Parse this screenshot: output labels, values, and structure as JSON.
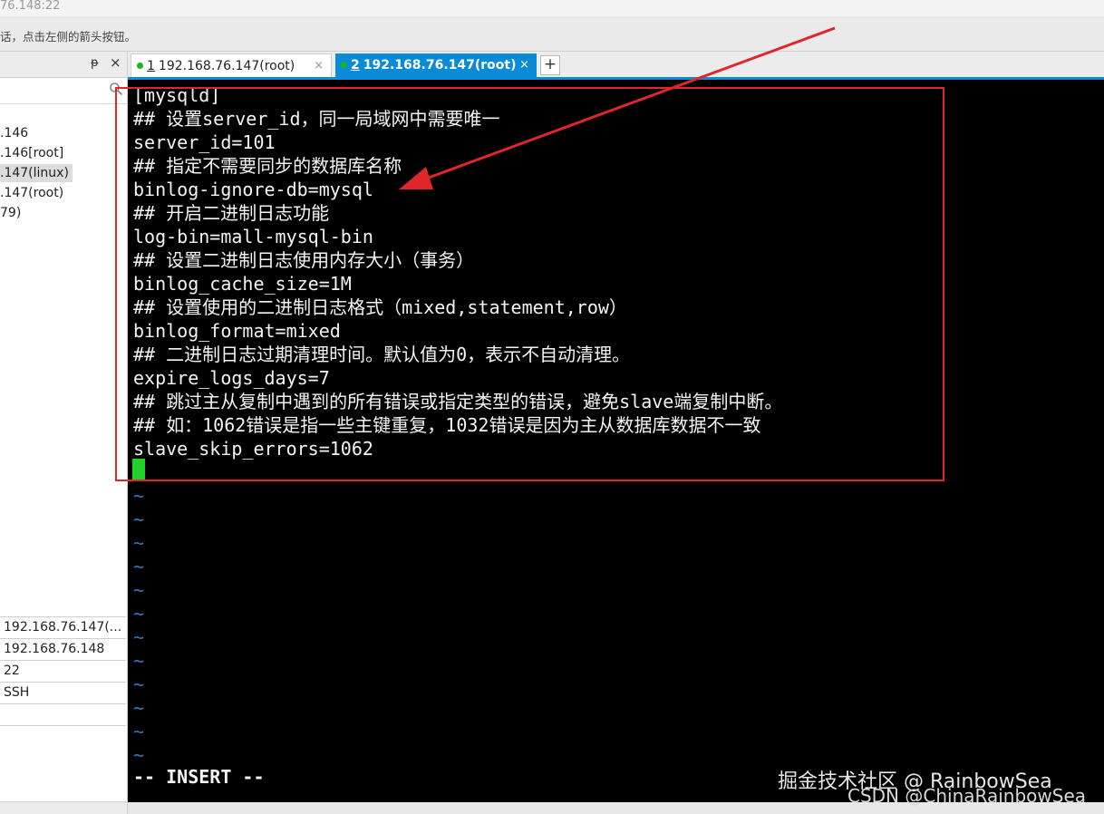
{
  "window": {
    "title": "76.148:22"
  },
  "infobar": {
    "text": "话，点击左侧的箭头按钮。"
  },
  "sidebar": {
    "pin_glyph": "ᵽ",
    "close_glyph": "×",
    "tree": [
      {
        "label": ".146"
      },
      {
        "label": ".146[root]"
      },
      {
        "label": ".147(linux)"
      },
      {
        "label": ".147(root)"
      },
      {
        "label": "79)"
      }
    ],
    "properties": [
      {
        "value": "192.168.76.147(..."
      },
      {
        "value": "192.168.76.148"
      },
      {
        "value": "22"
      },
      {
        "value": "SSH"
      },
      {
        "value": ""
      },
      {
        "value": ""
      }
    ]
  },
  "tabs": [
    {
      "num": "1",
      "label": "192.168.76.147(root)",
      "active": false
    },
    {
      "num": "2",
      "label": "192.168.76.147(root)",
      "active": true
    }
  ],
  "tab_close_glyph": "×",
  "add_tab_label": "+",
  "terminal": {
    "lines": [
      "[mysqld]",
      "## 设置server_id，同一局域网中需要唯一",
      "server_id=101",
      "## 指定不需要同步的数据库名称",
      "binlog-ignore-db=mysql",
      "## 开启二进制日志功能",
      "log-bin=mall-mysql-bin",
      "## 设置二进制日志使用内存大小（事务）",
      "binlog_cache_size=1M",
      "## 设置使用的二进制日志格式（mixed,statement,row）",
      "binlog_format=mixed",
      "## 二进制日志过期清理时间。默认值为0，表示不自动清理。",
      "expire_logs_days=7",
      "## 跳过主从复制中遇到的所有错误或指定类型的错误，避免slave端复制中断。",
      "## 如：1062错误是指一些主键重复，1032错误是因为主从数据库数据不一致",
      "slave_skip_errors=1062"
    ],
    "tilde": "~",
    "mode": "-- INSERT --"
  },
  "watermarks": {
    "juejin": "掘金技术社区 @ RainbowSea",
    "csdn": "CSDN @ChinaRainbowSea"
  },
  "colors": {
    "accent": "#0b8bd6",
    "highlight": "#e0262b",
    "cursor": "#22d22b",
    "terminal_bg": "#000000"
  }
}
